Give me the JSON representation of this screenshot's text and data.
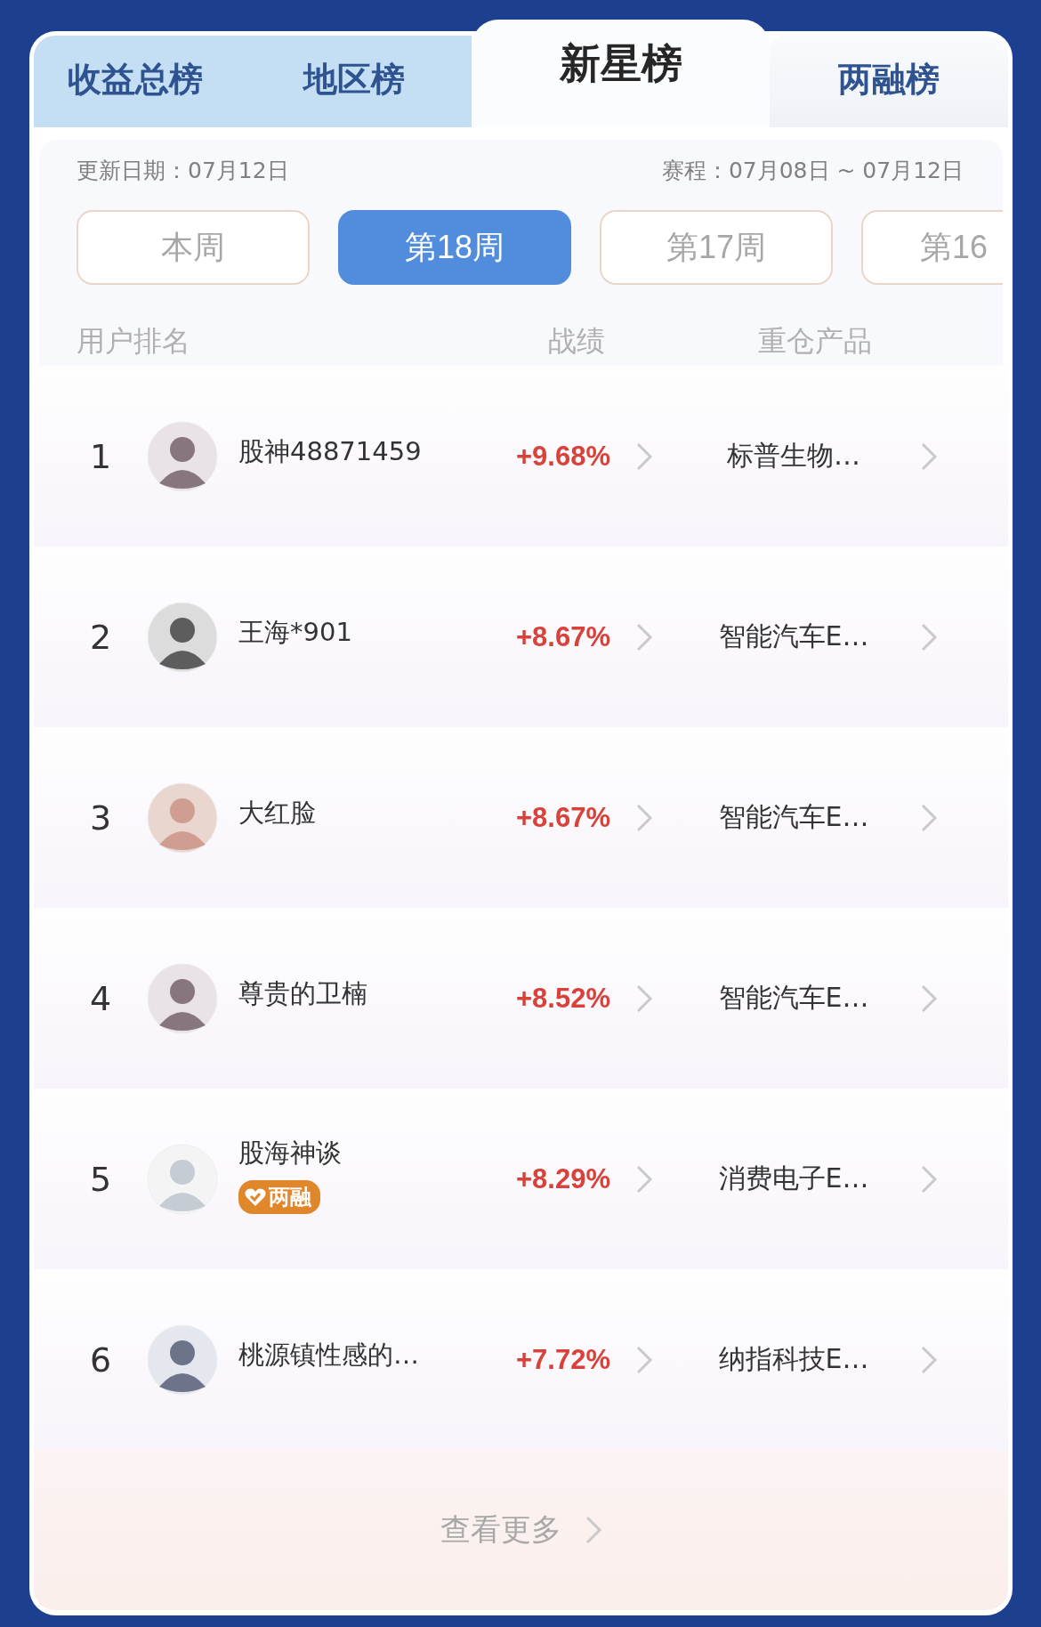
{
  "tabs": [
    {
      "label": "收益总榜",
      "selected": false
    },
    {
      "label": "地区榜",
      "selected": false
    },
    {
      "label": "新星榜",
      "selected": true
    },
    {
      "label": "两融榜",
      "selected": false
    }
  ],
  "update_date": {
    "label": "更新日期：",
    "value": "07月12日"
  },
  "schedule": {
    "label": "赛程：",
    "value": "07月08日 ~ 07月12日"
  },
  "weeks": [
    {
      "label": "本周",
      "selected": false
    },
    {
      "label": "第18周",
      "selected": true
    },
    {
      "label": "第17周",
      "selected": false
    },
    {
      "label": "第16",
      "selected": false
    }
  ],
  "columns": [
    "用户排名",
    "战绩",
    "重仓产品"
  ],
  "rows": [
    {
      "rank": "1",
      "name": "股神48871459",
      "return": "+9.68%",
      "product": "标普生物…"
    },
    {
      "rank": "2",
      "name": "王海*901",
      "return": "+8.67%",
      "product": "智能汽车E…"
    },
    {
      "rank": "3",
      "name": "大红脸",
      "return": "+8.67%",
      "product": "智能汽车E…"
    },
    {
      "rank": "4",
      "name": "尊贵的卫楠",
      "return": "+8.52%",
      "product": "智能汽车E…"
    },
    {
      "rank": "5",
      "name": "股海神谈",
      "badge": "两融",
      "return": "+8.29%",
      "product": "消费电子E…"
    },
    {
      "rank": "6",
      "name": "桃源镇性感的…",
      "return": "+7.72%",
      "product": "纳指科技E…"
    }
  ],
  "more": "查看更多"
}
